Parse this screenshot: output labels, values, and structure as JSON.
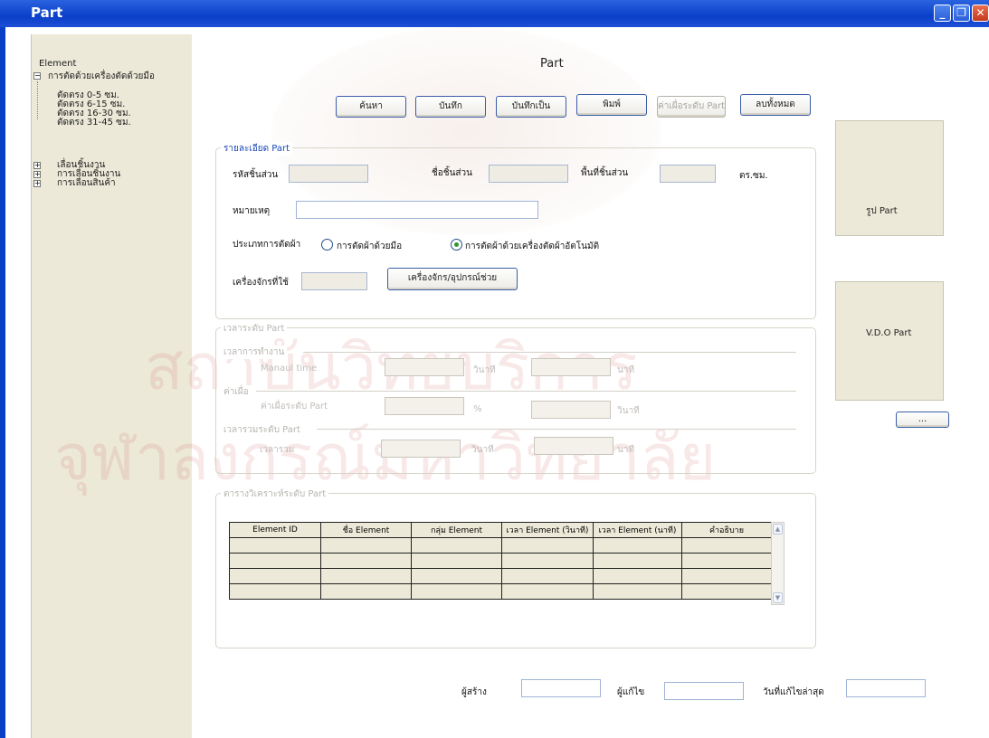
{
  "window": {
    "title": "Part"
  },
  "tree": {
    "root": "Element",
    "node1": "การตัดด้วยเครื่องตัดด้วยมือ",
    "leaves": [
      "ตัดตรง 0-5 ซม.",
      "ตัดตรง 6-15 ซม.",
      "ตัดตรง 16-30 ซม.",
      "ตัดตรง 31-45 ซม."
    ],
    "collapsed": [
      "เลื่อนชิ้นงาน",
      "การเลื่อนชิ้นงาน",
      "การเลื่อนสินค้า"
    ]
  },
  "header": {
    "title": "Part"
  },
  "toolbar": {
    "search": "ค้นหา",
    "save": "บันทึก",
    "save_as": "บันทึกเป็น",
    "print": "พิมพ์",
    "allowance": "ค่าเผื่อระดับ Part",
    "delete_all": "ลบทั้งหมด"
  },
  "details": {
    "legend": "รายละเอียด Part",
    "part_code": "รหัสชิ้นส่วน",
    "part_name": "ชื่อชิ้นส่วน",
    "part_area": "พื้นที่ชิ้นส่วน",
    "area_unit": "ตร.ซม.",
    "note": "หมายเหตุ",
    "cut_type": "ประเภทการตัดผ้า",
    "radio_manual": "การตัดผ้าด้วยมือ",
    "radio_auto": "การตัดผ้าด้วยเครื่องตัดผ้าอัตโนมัติ",
    "machine": "เครื่องจักรที่ใช้",
    "machine_button": "เครื่องจักร/อุปกรณ์ช่วย"
  },
  "time": {
    "legend": "เวลาระดับ Part",
    "work": "เวลาการทำงาน",
    "manual_time": "Manaul time",
    "sec": "วินาที",
    "min": "นาที",
    "allowance": "ค่าเผื่อ",
    "allowance_part": "ค่าเผื่อระดับ Part",
    "percent": "%",
    "total_group": "เวลารวมระดับ Part",
    "total": "เวลารวม"
  },
  "analysis": {
    "legend": "ตารางวิเคราะห์ระดับ Part",
    "columns": [
      "Element ID",
      "ชื่อ Element",
      "กลุ่ม Element",
      "เวลา Element (วินาที)",
      "เวลา Element  (นาที)",
      "คำอธิบาย"
    ]
  },
  "side": {
    "picture": "รูป Part",
    "video": "V.D.O Part",
    "browse": "..."
  },
  "footer": {
    "creator": "ผู้สร้าง",
    "editor": "ผู้แก้ไข",
    "last_edit": "วันที่แก้ไขล่าสุด"
  },
  "watermark": {
    "line1": "สถาบันวิทยบริการ",
    "line2": "จุฬาลงกรณ์มหาวิทยาลัย"
  }
}
